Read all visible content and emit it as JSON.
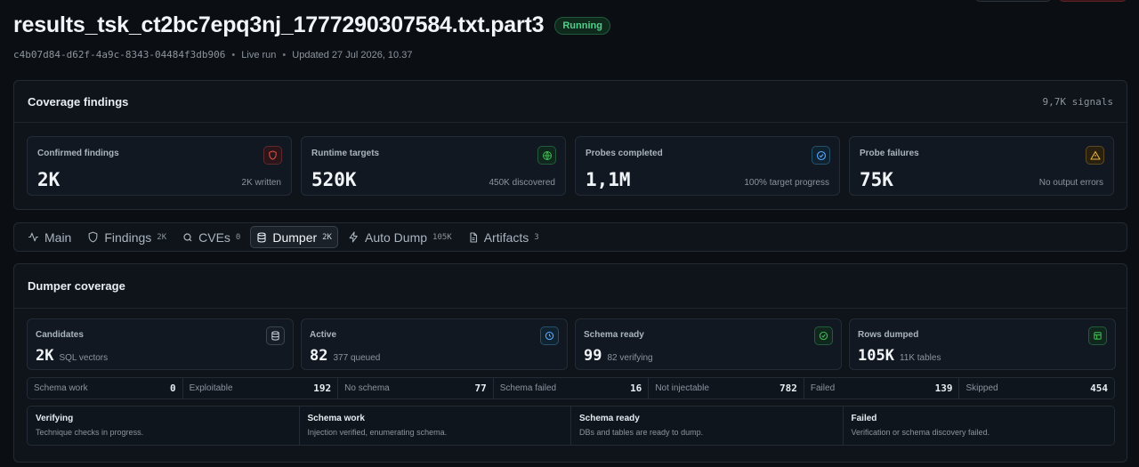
{
  "header": {
    "title": "results_tsk_ct2bc7epq3nj_1777290307584.txt.part3",
    "status": "Running",
    "job_id": "c4b07d84-d62f-4a9c-8343-04484f3db906",
    "mode": "Live run",
    "updated": "Updated 27 Jul 2026, 10.37"
  },
  "coverage": {
    "title": "Coverage findings",
    "signals": "9,7K signals",
    "cards": [
      {
        "label": "Confirmed findings",
        "value": "2K",
        "sub": "2K written",
        "icon": "shield-icon",
        "color": "#e5534b"
      },
      {
        "label": "Runtime targets",
        "value": "520K",
        "sub": "450K discovered",
        "icon": "globe-icon",
        "color": "#3fb950"
      },
      {
        "label": "Probes completed",
        "value": "1,1M",
        "sub": "100% target progress",
        "icon": "check-circle-icon",
        "color": "#58a6ff"
      },
      {
        "label": "Probe failures",
        "value": "75K",
        "sub": "No output errors",
        "icon": "warning-icon",
        "color": "#d29922"
      }
    ]
  },
  "tabs": [
    {
      "label": "Main",
      "count": "",
      "icon": "activity-icon"
    },
    {
      "label": "Findings",
      "count": "2K",
      "icon": "shield-icon"
    },
    {
      "label": "CVEs",
      "count": "0",
      "icon": "search-icon"
    },
    {
      "label": "Dumper",
      "count": "2K",
      "icon": "database-icon",
      "active": true
    },
    {
      "label": "Auto Dump",
      "count": "105K",
      "icon": "bolt-icon"
    },
    {
      "label": "Artifacts",
      "count": "3",
      "icon": "file-icon"
    }
  ],
  "dumper": {
    "title": "Dumper coverage",
    "cards": [
      {
        "label": "Candidates",
        "value": "2K",
        "sub": "SQL vectors",
        "icon": "database-icon"
      },
      {
        "label": "Active",
        "value": "82",
        "sub": "377 queued",
        "icon": "clock-icon"
      },
      {
        "label": "Schema ready",
        "value": "99",
        "sub": "82 verifying",
        "icon": "check-circle-icon"
      },
      {
        "label": "Rows dumped",
        "value": "105K",
        "sub": "11K tables",
        "icon": "table-icon"
      }
    ],
    "stats": [
      {
        "label": "Schema work",
        "value": "0"
      },
      {
        "label": "Exploitable",
        "value": "192"
      },
      {
        "label": "No schema",
        "value": "77"
      },
      {
        "label": "Schema failed",
        "value": "16"
      },
      {
        "label": "Not injectable",
        "value": "782"
      },
      {
        "label": "Failed",
        "value": "139"
      },
      {
        "label": "Skipped",
        "value": "454"
      }
    ],
    "legend": [
      {
        "title": "Verifying",
        "desc": "Technique checks in progress."
      },
      {
        "title": "Schema work",
        "desc": "Injection verified, enumerating schema."
      },
      {
        "title": "Schema ready",
        "desc": "DBs and tables are ready to dump."
      },
      {
        "title": "Failed",
        "desc": "Verification or schema discovery failed."
      }
    ]
  }
}
